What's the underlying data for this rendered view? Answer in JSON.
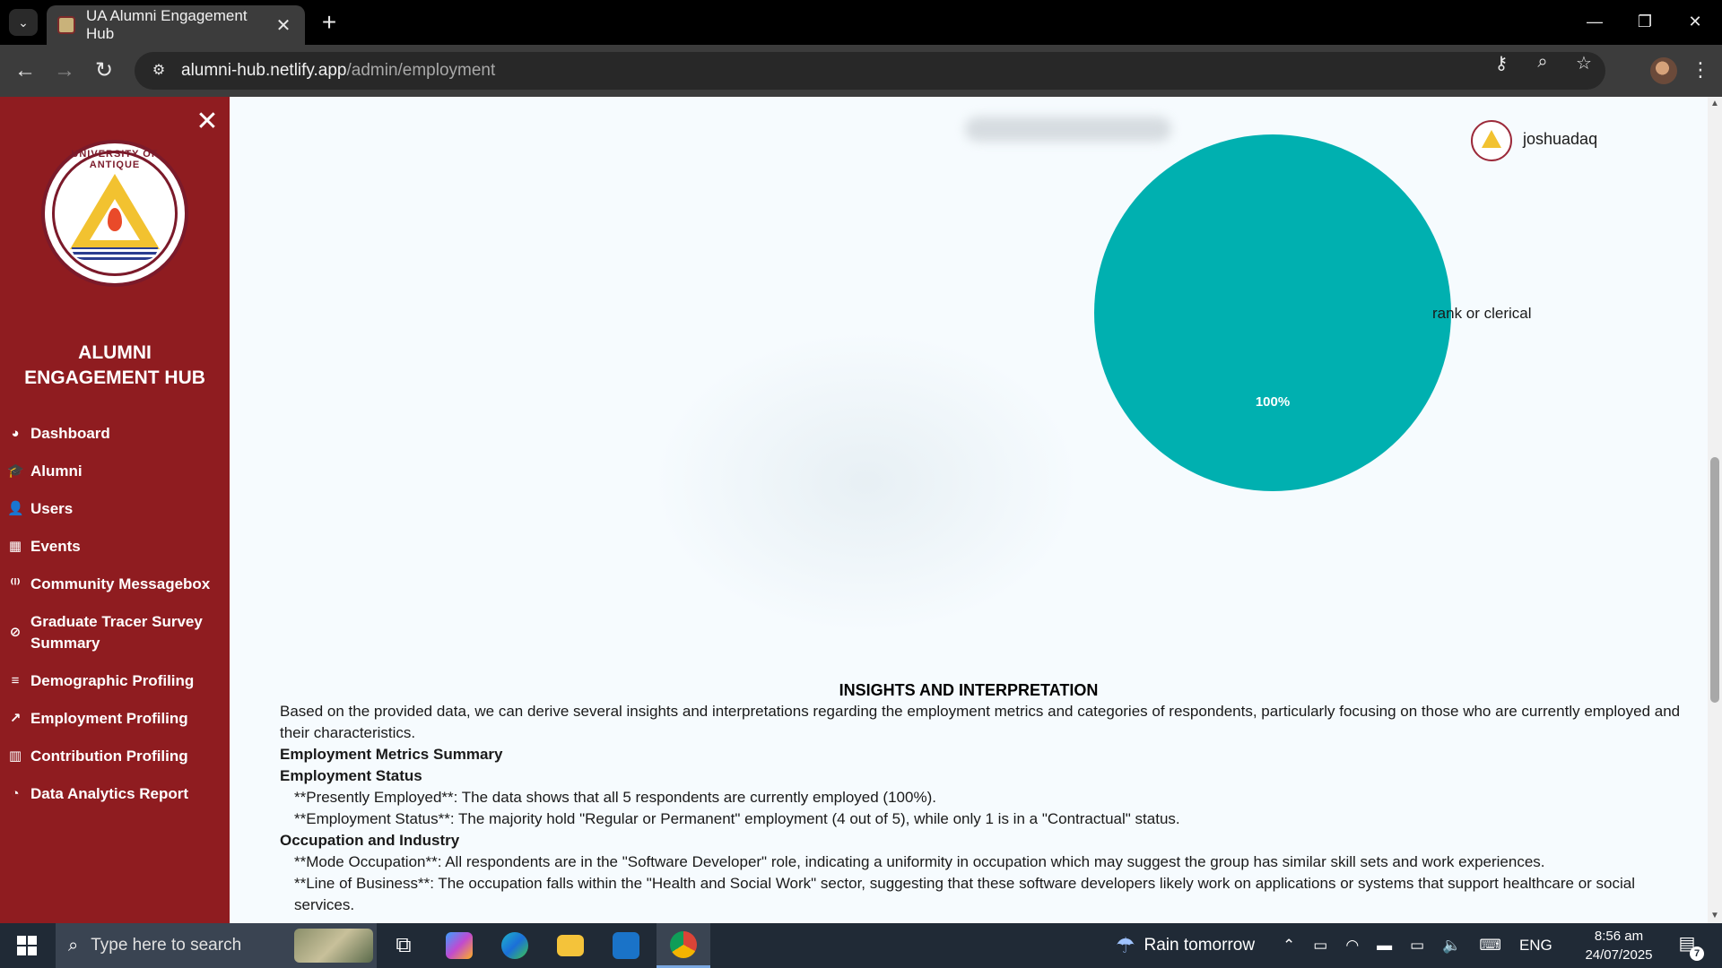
{
  "browser": {
    "tab_title": "UA Alumni Engagement Hub",
    "url_host": "alumni-hub.netlify.app",
    "url_path": "/admin/employment",
    "tab_close": "✕",
    "new_tab": "+",
    "win_minimize": "—",
    "win_restore": "❐",
    "win_close": "✕"
  },
  "sidebar": {
    "close": "✕",
    "logo_text": "UNIVERSITY OF ANTIQUE",
    "brand": "ALUMNI ENGAGEMENT HUB",
    "items": [
      {
        "label": "Dashboard",
        "icon": "◕"
      },
      {
        "label": "Alumni",
        "icon": "🎓"
      },
      {
        "label": "Users",
        "icon": "👤"
      },
      {
        "label": "Events",
        "icon": "▦"
      },
      {
        "label": "Community Messagebox",
        "icon": "⁽ᴵ⁾"
      },
      {
        "label": "Graduate Tracer Survey Summary",
        "icon": "⊘"
      },
      {
        "label": "Demographic Profiling",
        "icon": "≡"
      },
      {
        "label": "Employment Profiling",
        "icon": "↗"
      },
      {
        "label": "Contribution Profiling",
        "icon": "▥"
      },
      {
        "label": "Data Analytics Report",
        "icon": "◔"
      }
    ]
  },
  "header": {
    "username": "joshuadaq"
  },
  "chart_data": {
    "type": "pie",
    "slices": [
      {
        "label": "rank or clerical",
        "value": 100,
        "percent_label": "100%",
        "color": "#00b0b0"
      }
    ]
  },
  "insights": {
    "title": "INSIGHTS AND INTERPRETATION",
    "intro": "Based on the provided data, we can derive several insights and interpretations regarding the employment metrics and categories of respondents, particularly focusing on those who are currently employed and their characteristics.",
    "h_summary": "Employment Metrics Summary",
    "h_status": "Employment Status",
    "status_1": "**Presently Employed**: The data shows that all 5 respondents are currently employed (100%).",
    "status_2": "**Employment Status**: The majority hold \"Regular or Permanent\" employment (4 out of 5), while only 1 is in a \"Contractual\" status.",
    "h_occupation": "Occupation and Industry",
    "occ_1": "**Mode Occupation**: All respondents are in the \"Software Developer\" role, indicating a uniformity in occupation which may suggest the group has similar skill sets and work experiences.",
    "occ_2": "**Line of Business**: The occupation falls within the \"Health and Social Work\" sector, suggesting that these software developers likely work on applications or systems that support healthcare or social services."
  },
  "taskbar": {
    "search_placeholder": "Type here to search",
    "weather": "Rain tomorrow",
    "lang": "ENG",
    "time": "8:56 am",
    "date": "24/07/2025",
    "notif_count": "7"
  }
}
